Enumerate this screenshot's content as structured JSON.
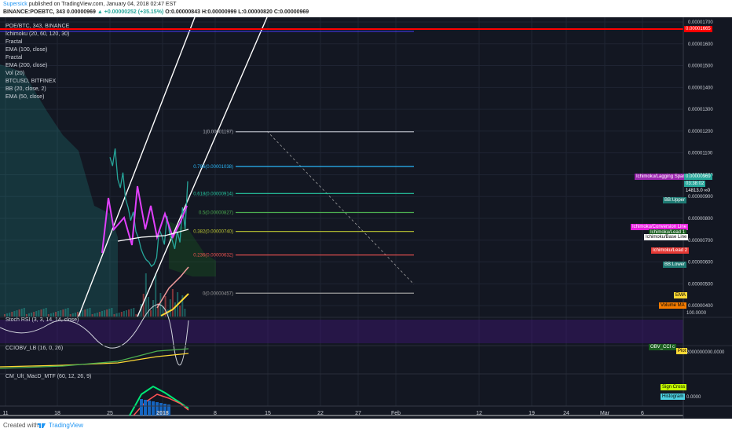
{
  "header": {
    "author": "Supersick",
    "published": "published on TradingView.com, January 04, 2018 02:47 EST",
    "symbol_line": "BINANCE:POEBTC, 343",
    "last": "0.00000969",
    "change": "+0.00000252 (+35.15%)",
    "open": "O:0.00000843",
    "high": "H:0.00000999",
    "low": "L:0.00000820",
    "close": "C:0.00000969"
  },
  "indicators": [
    "POE/BTC, 343, BINANCE",
    "Ichimoku (20, 60, 120, 30)",
    "Fractal",
    "EMA (100, close)",
    "Fractal",
    "EMA (200, close)",
    "Vol (20)",
    "BTCUSD, BITFINEX",
    "BB (20, close, 2)",
    "EMA (50, close)"
  ],
  "pane_titles": {
    "stoch": "Stoch RSI (3, 3, 14, 14, close)",
    "cciobv": "CCIOBV_LB (16, 0, 26)",
    "macd": "CM_Ult_MacD_MTF (60, 12, 26, 9)"
  },
  "right_tags": {
    "lagging": "Ichimoku/Lagging Span",
    "price": "0.00000969",
    "timer": "03:38:02",
    "volume": "14813.0 ∞0",
    "bb_upper": "BB:Upper",
    "conversion": "Ichimoku/Conversion Line",
    "lead1": "Ichimoku/Lead 1",
    "base": "Ichimoku/Base Line",
    "lead2": "Ichimoku/Lead 2",
    "bb_lower": "BB:Lower",
    "ema": "EMA",
    "volume_ma": "Volume MA",
    "obv_cci": "OBV_CCI c",
    "plot": "Plot",
    "sign_cross": "Sign Cross",
    "histogram": "Histogram",
    "resistance": "0.00001665"
  },
  "pane_axis": {
    "stoch_top": "100.0000",
    "cci_val": "2000000000.0000",
    "macd_zero": "0.0000"
  },
  "x_labels": [
    "11",
    "18",
    "25",
    "2018",
    "8",
    "15",
    "22",
    "27",
    "Feb",
    "12",
    "19",
    "24",
    "Mar",
    "6"
  ],
  "footer": {
    "created": "Created with",
    "brand": "TradingView"
  },
  "colors": {
    "bg": "#131722",
    "up": "#26a69a",
    "down": "#ef5350",
    "stoch": "#9c27b0",
    "resistance": "#ff0000"
  },
  "chart_data": {
    "type": "line",
    "title": "POE/BTC, 343, BINANCE",
    "ylim": [
      3.5e-06,
      1.7e-05
    ],
    "y_ticks": [
      "0.00001700",
      "0.00001600",
      "0.00001500",
      "0.00001400",
      "0.00001300",
      "0.00001200",
      "0.00001100",
      "0.00001000",
      "0.00000900",
      "0.00000800",
      "0.00000700",
      "0.00000600",
      "0.00000500",
      "0.00000400"
    ],
    "fib_levels": [
      {
        "label": "1(0.00001197)",
        "value": 1.197e-05,
        "color": "#b2b5be"
      },
      {
        "label": "0.786(0.00001038)",
        "value": 1.038e-05,
        "color": "#29b6f6"
      },
      {
        "label": "0.618(0.00000914)",
        "value": 9.14e-06,
        "color": "#26c6a0"
      },
      {
        "label": "0.5(0.00000827)",
        "value": 8.27e-06,
        "color": "#4caf50"
      },
      {
        "label": "0.382(0.00000740)",
        "value": 7.4e-06,
        "color": "#c0ca33"
      },
      {
        "label": "0.236(0.00000632)",
        "value": 6.32e-06,
        "color": "#ef5350"
      },
      {
        "label": "0(0.00000457)",
        "value": 4.57e-06,
        "color": "#9e9e9e"
      }
    ],
    "series": [
      {
        "values": [
          1.08e-05,
          1.04e-05,
          1.12e-05,
          9.8e-06,
          9.4e-06,
          1.01e-05,
          8.9e-06,
          8.5e-06,
          7.9e-06,
          8.3e-06,
          7.4e-06,
          7.1e-06,
          6.6e-06,
          6.3e-06,
          6.1e-06,
          6e-06,
          5.8e-06,
          5.9e-06,
          6.2e-06,
          7.5e-06,
          7.2e-06,
          6.8e-06,
          8.1e-06,
          7.3e-06,
          7e-06,
          6.6e-06,
          7.4e-06,
          6.9e-06,
          8.5e-06,
          7.5e-06,
          9.7e-06
        ]
      }
    ]
  }
}
